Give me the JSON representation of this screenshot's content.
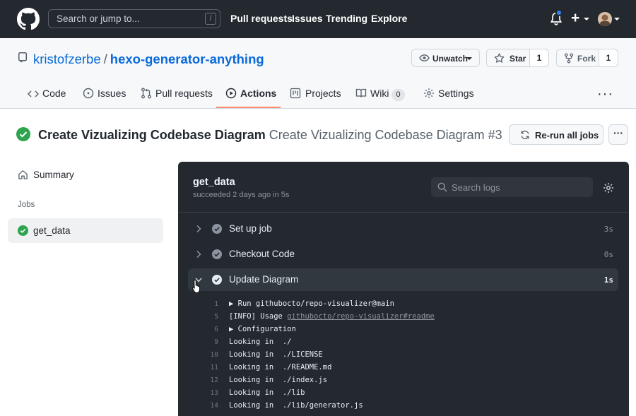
{
  "header": {
    "search_placeholder": "Search or jump to...",
    "search_shortcut": "/",
    "nav": [
      "Pull requests",
      "Issues",
      "Trending",
      "Explore"
    ]
  },
  "repo": {
    "owner": "kristofzerbe",
    "separator": "/",
    "name": "hexo-generator-anything",
    "unwatch_label": "Unwatch",
    "star_label": "Star",
    "star_count": "1",
    "fork_label": "Fork",
    "fork_count": "1"
  },
  "tabs": [
    {
      "label": "Code",
      "icon": "code-icon"
    },
    {
      "label": "Issues",
      "icon": "issue-icon"
    },
    {
      "label": "Pull requests",
      "icon": "pull-request-icon"
    },
    {
      "label": "Actions",
      "icon": "play-icon",
      "active": true
    },
    {
      "label": "Projects",
      "icon": "project-icon"
    },
    {
      "label": "Wiki",
      "icon": "book-icon",
      "count": "0"
    },
    {
      "label": "Settings",
      "icon": "gear-icon"
    }
  ],
  "run": {
    "workflow_name": "Create Vizualizing Codebase Diagram",
    "run_name": "Create Vizualizing Codebase Diagram #3",
    "rerun_label": "Re-run all jobs",
    "status": "success"
  },
  "sidebar": {
    "summary_label": "Summary",
    "jobs_heading": "Jobs",
    "jobs": [
      {
        "label": "get_data",
        "status": "success"
      }
    ]
  },
  "log": {
    "job_name": "get_data",
    "job_status": "succeeded 2 days ago in 5s",
    "search_placeholder": "Search logs",
    "steps": [
      {
        "name": "Set up job",
        "duration": "3s"
      },
      {
        "name": "Checkout Code",
        "duration": "0s"
      },
      {
        "name": "Update Diagram",
        "duration": "1s",
        "expanded": true
      }
    ],
    "lines": [
      {
        "num": "1",
        "text": "▶ Run githubocto/repo-visualizer@main"
      },
      {
        "num": "5",
        "text": "[INFO] Usage ",
        "link": "githubocto/repo-visualizer#readme"
      },
      {
        "num": "6",
        "text": "▶ Configuration"
      },
      {
        "num": "9",
        "text": "Looking in  ./"
      },
      {
        "num": "10",
        "text": "Looking in  ./LICENSE"
      },
      {
        "num": "11",
        "text": "Looking in  ./README.md"
      },
      {
        "num": "12",
        "text": "Looking in  ./index.js"
      },
      {
        "num": "13",
        "text": "Looking in  ./lib"
      },
      {
        "num": "14",
        "text": "Looking in  ./lib/generator.js"
      }
    ]
  },
  "colors": {
    "header_bg": "#24292f",
    "link": "#0969da",
    "success": "#2da44e",
    "active_tab_underline": "#fd8c73",
    "log_bg": "#24292f"
  }
}
